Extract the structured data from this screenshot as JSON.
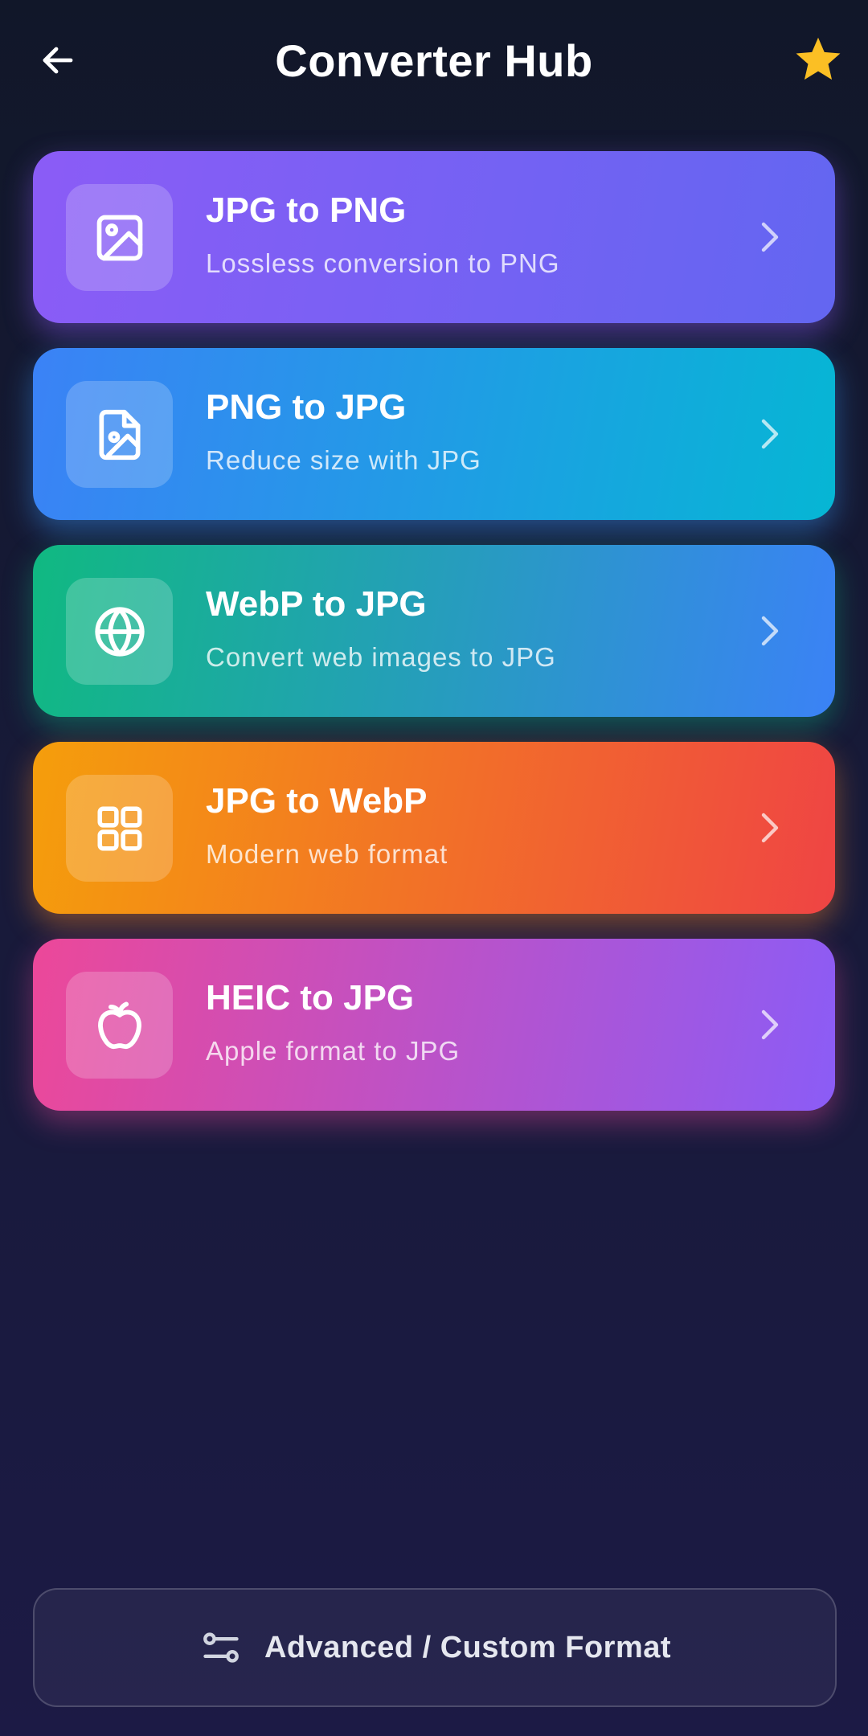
{
  "header": {
    "title": "Converter Hub",
    "back_icon": "arrow-left-icon",
    "favorite_icon": "star-icon",
    "star_color": "#fbbf24"
  },
  "cards": [
    {
      "title": "JPG to PNG",
      "subtitle": "Lossless conversion to PNG",
      "icon": "image-icon",
      "gradient": [
        "#8b5cf6",
        "#6366f1"
      ],
      "glow": "rgba(139,92,246,0.45)"
    },
    {
      "title": "PNG to JPG",
      "subtitle": "Reduce size with JPG",
      "icon": "file-image-icon",
      "gradient": [
        "#3b82f6",
        "#06b6d4"
      ],
      "glow": "rgba(56,150,246,0.45)"
    },
    {
      "title": "WebP to JPG",
      "subtitle": "Convert web images to JPG",
      "icon": "globe-icon",
      "gradient": [
        "#10b981",
        "#3b82f6"
      ],
      "glow": "rgba(16,185,129,0.4)"
    },
    {
      "title": "JPG to WebP",
      "subtitle": "Modern web format",
      "icon": "grid-icon",
      "gradient": [
        "#f59e0b",
        "#ef4444"
      ],
      "glow": "rgba(245,130,40,0.45)"
    },
    {
      "title": "HEIC to JPG",
      "subtitle": "Apple format to JPG",
      "icon": "apple-icon",
      "gradient": [
        "#ec4899",
        "#8b5cf6"
      ],
      "glow": "rgba(236,72,153,0.4)"
    }
  ],
  "advanced": {
    "label": "Advanced / Custom Format",
    "icon": "sliders-icon"
  }
}
